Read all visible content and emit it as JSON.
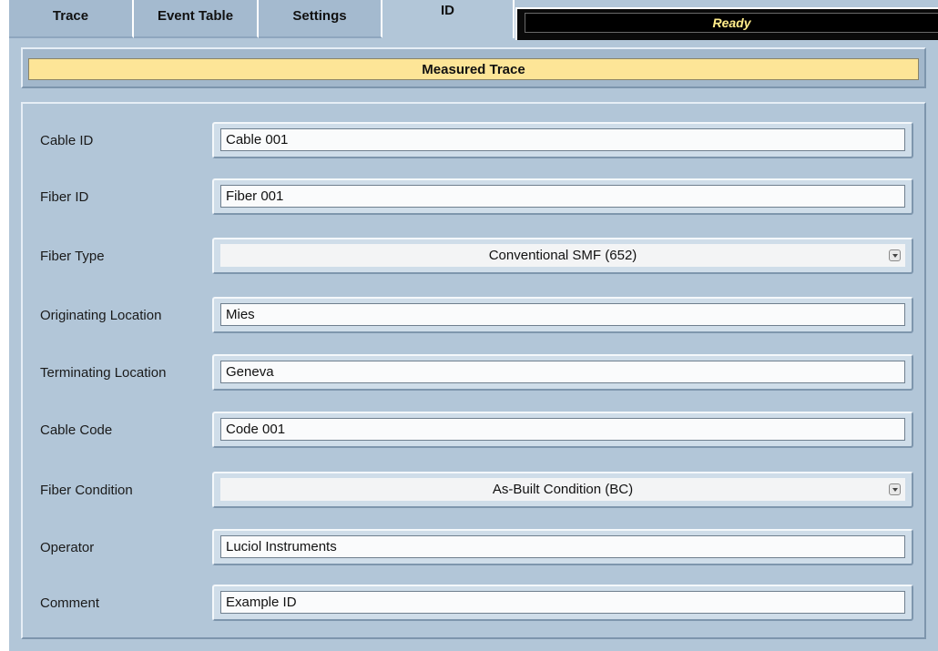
{
  "tabs": [
    {
      "label": "Trace"
    },
    {
      "label": "Event Table"
    },
    {
      "label": "Settings"
    },
    {
      "label": "ID"
    }
  ],
  "status": {
    "text": "Ready"
  },
  "header": {
    "title": "Measured Trace"
  },
  "fields": [
    {
      "label": "Cable ID",
      "value": "Cable 001",
      "kind": "text"
    },
    {
      "label": "Fiber ID",
      "value": "Fiber 001",
      "kind": "text"
    },
    {
      "label": "Fiber Type",
      "value": "Conventional SMF (652)",
      "kind": "select"
    },
    {
      "label": "Originating Location",
      "value": "Mies",
      "kind": "text"
    },
    {
      "label": "Terminating Location",
      "value": "Geneva",
      "kind": "text"
    },
    {
      "label": "Cable Code",
      "value": "Code 001",
      "kind": "text"
    },
    {
      "label": "Fiber Condition",
      "value": "As-Built Condition (BC)",
      "kind": "select"
    },
    {
      "label": "Operator",
      "value": "Luciol Instruments",
      "kind": "text"
    },
    {
      "label": "Comment",
      "value": "Example ID",
      "kind": "text"
    }
  ],
  "colors": {
    "background": "#b2c6d8",
    "header_bar": "#fde597",
    "status_bg": "#000000",
    "status_text": "#ffec8a"
  }
}
